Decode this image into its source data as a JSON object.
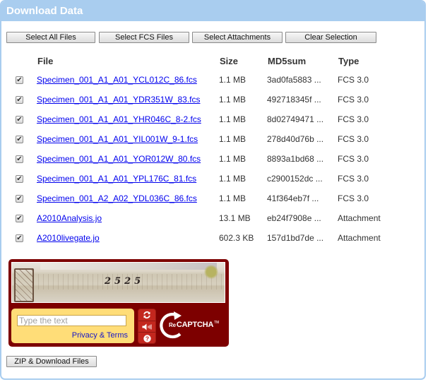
{
  "panel": {
    "title": "Download Data"
  },
  "toolbar": {
    "select_all": "Select All Files",
    "select_fcs": "Select FCS Files",
    "select_attachments": "Select Attachments",
    "clear_selection": "Clear Selection"
  },
  "table": {
    "columns": {
      "file": "File",
      "size": "Size",
      "md5": "MD5sum",
      "type": "Type"
    },
    "rows": [
      {
        "checked": true,
        "file": "Specimen_001_A1_A01_YCL012C_86.fcs",
        "size": "1.1 MB",
        "md5": "3ad0fa5883 ...",
        "type": "FCS 3.0"
      },
      {
        "checked": true,
        "file": "Specimen_001_A1_A01_YDR351W_83.fcs",
        "size": "1.1 MB",
        "md5": "492718345f ...",
        "type": "FCS 3.0"
      },
      {
        "checked": true,
        "file": "Specimen_001_A1_A01_YHR046C_8-2.fcs",
        "size": "1.1 MB",
        "md5": "8d02749471 ...",
        "type": "FCS 3.0"
      },
      {
        "checked": true,
        "file": "Specimen_001_A1_A01_YIL001W_9-1.fcs",
        "size": "1.1 MB",
        "md5": "278d40d76b ...",
        "type": "FCS 3.0"
      },
      {
        "checked": true,
        "file": "Specimen_001_A1_A01_YOR012W_80.fcs",
        "size": "1.1 MB",
        "md5": "8893a1bd68 ...",
        "type": "FCS 3.0"
      },
      {
        "checked": true,
        "file": "Specimen_001_A1_A01_YPL176C_81.fcs",
        "size": "1.1 MB",
        "md5": "c2900152dc ...",
        "type": "FCS 3.0"
      },
      {
        "checked": true,
        "file": "Specimen_001_A2_A02_YDL036C_86.fcs",
        "size": "1.1 MB",
        "md5": "41f364eb7f ...",
        "type": "FCS 3.0"
      },
      {
        "checked": true,
        "file": "A2010Analysis.jo",
        "size": "13.1 MB",
        "md5": "eb24f7908e ...",
        "type": "Attachment"
      },
      {
        "checked": true,
        "file": "A2010livegate.jo",
        "size": "602.3 KB",
        "md5": "157d1bd7de ...",
        "type": "Attachment"
      }
    ]
  },
  "captcha": {
    "image_text": "2525",
    "input_value": "",
    "input_placeholder": "Type the text",
    "privacy_link": "Privacy & Terms",
    "brand_re": "Re",
    "brand_name": "CAPTCHA",
    "brand_tm": "TM",
    "colors": {
      "frame": "#7d0000",
      "answer_box": "#ffdd78",
      "controls": "#c3271e"
    }
  },
  "footer": {
    "zip_download": "ZIP & Download Files"
  },
  "colors": {
    "header": "#a9cdef",
    "link": "#0000ee"
  }
}
